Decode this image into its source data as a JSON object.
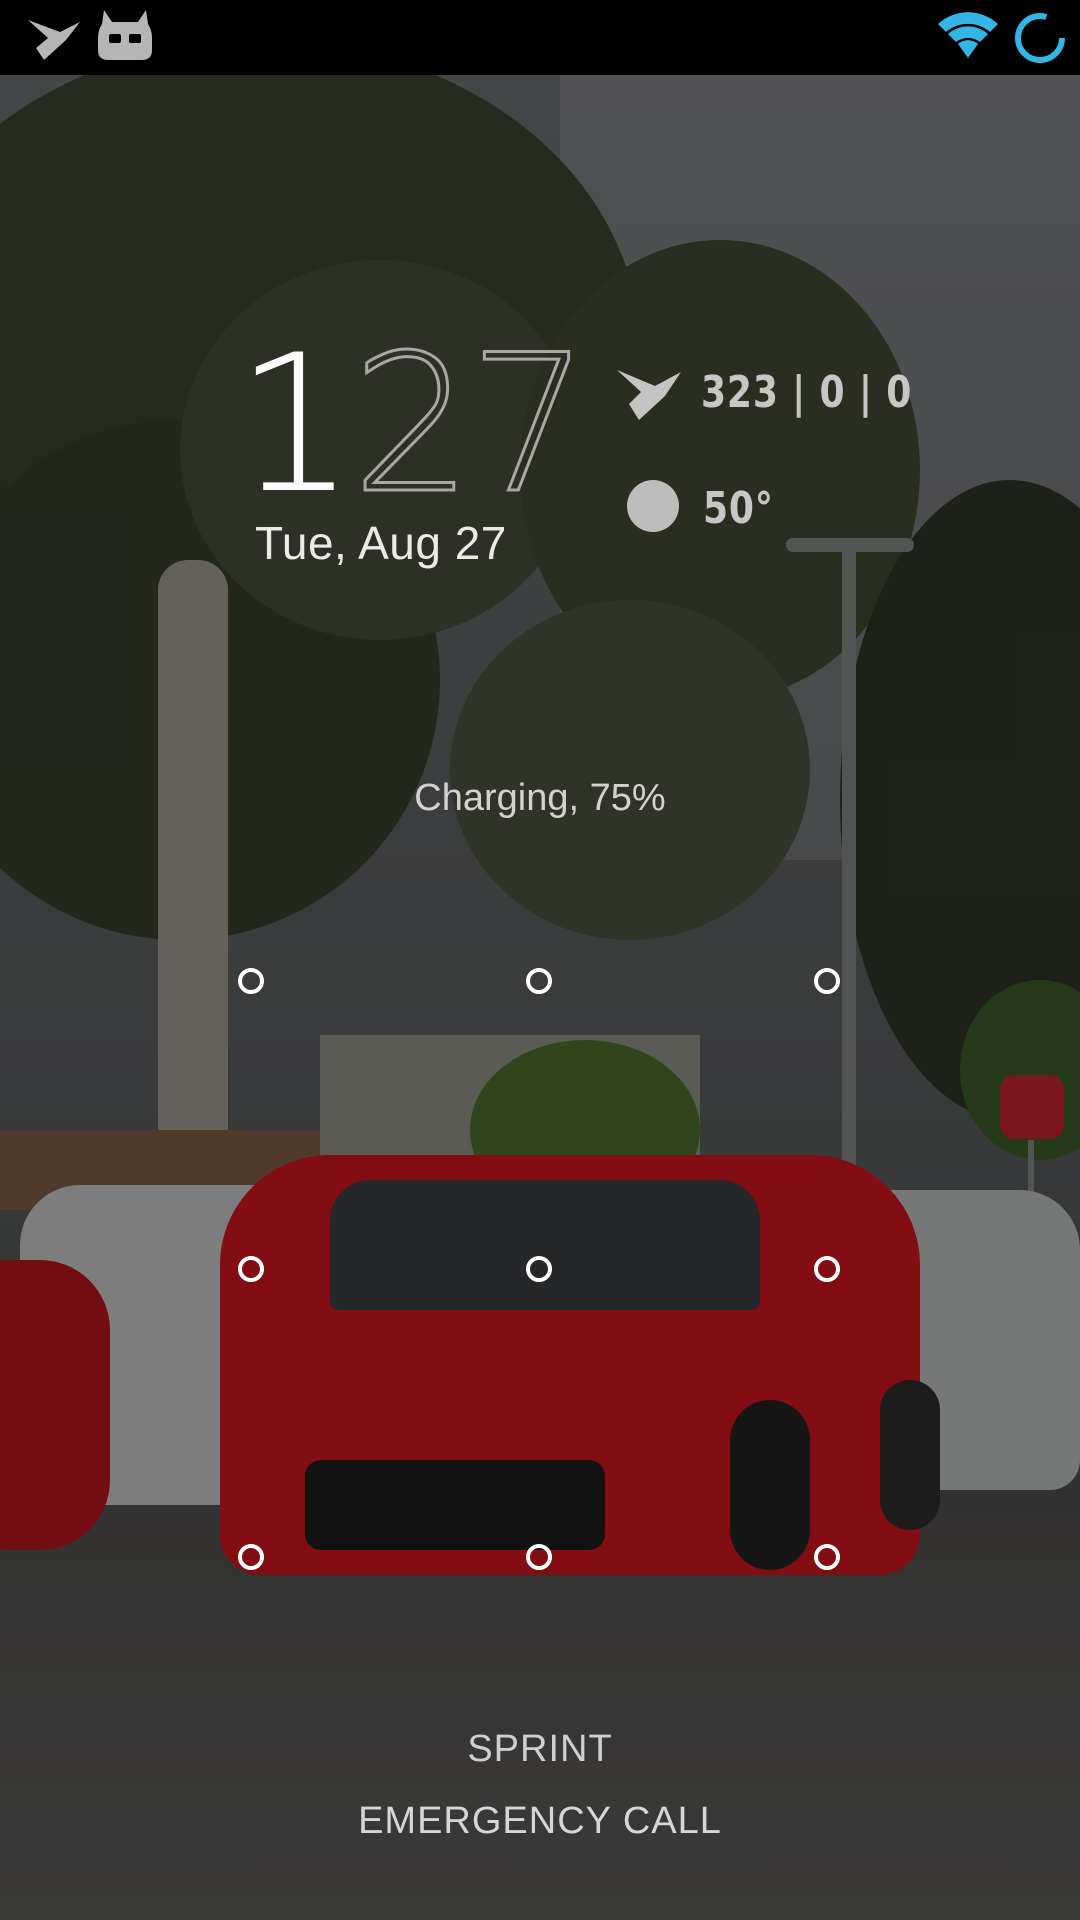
{
  "status_bar": {
    "left_icons": [
      "notification-bird-icon",
      "cyanogenmod-icon"
    ],
    "right_icons": [
      "wifi-icon",
      "sync-spinner-icon"
    ],
    "accent_color": "#33b5e5"
  },
  "clock": {
    "hour": "1",
    "minutes": "27",
    "date": "Tue, Aug 27"
  },
  "weather": {
    "notification_icon": "notification-bird-icon",
    "counts": "323 | 0 | 0",
    "condition_icon": "moon-icon",
    "temperature": "50°"
  },
  "battery": {
    "status": "Charging, 75%"
  },
  "pattern_lock": {
    "dots": 9
  },
  "carrier": "SPRINT",
  "emergency_call": "EMERGENCY CALL"
}
